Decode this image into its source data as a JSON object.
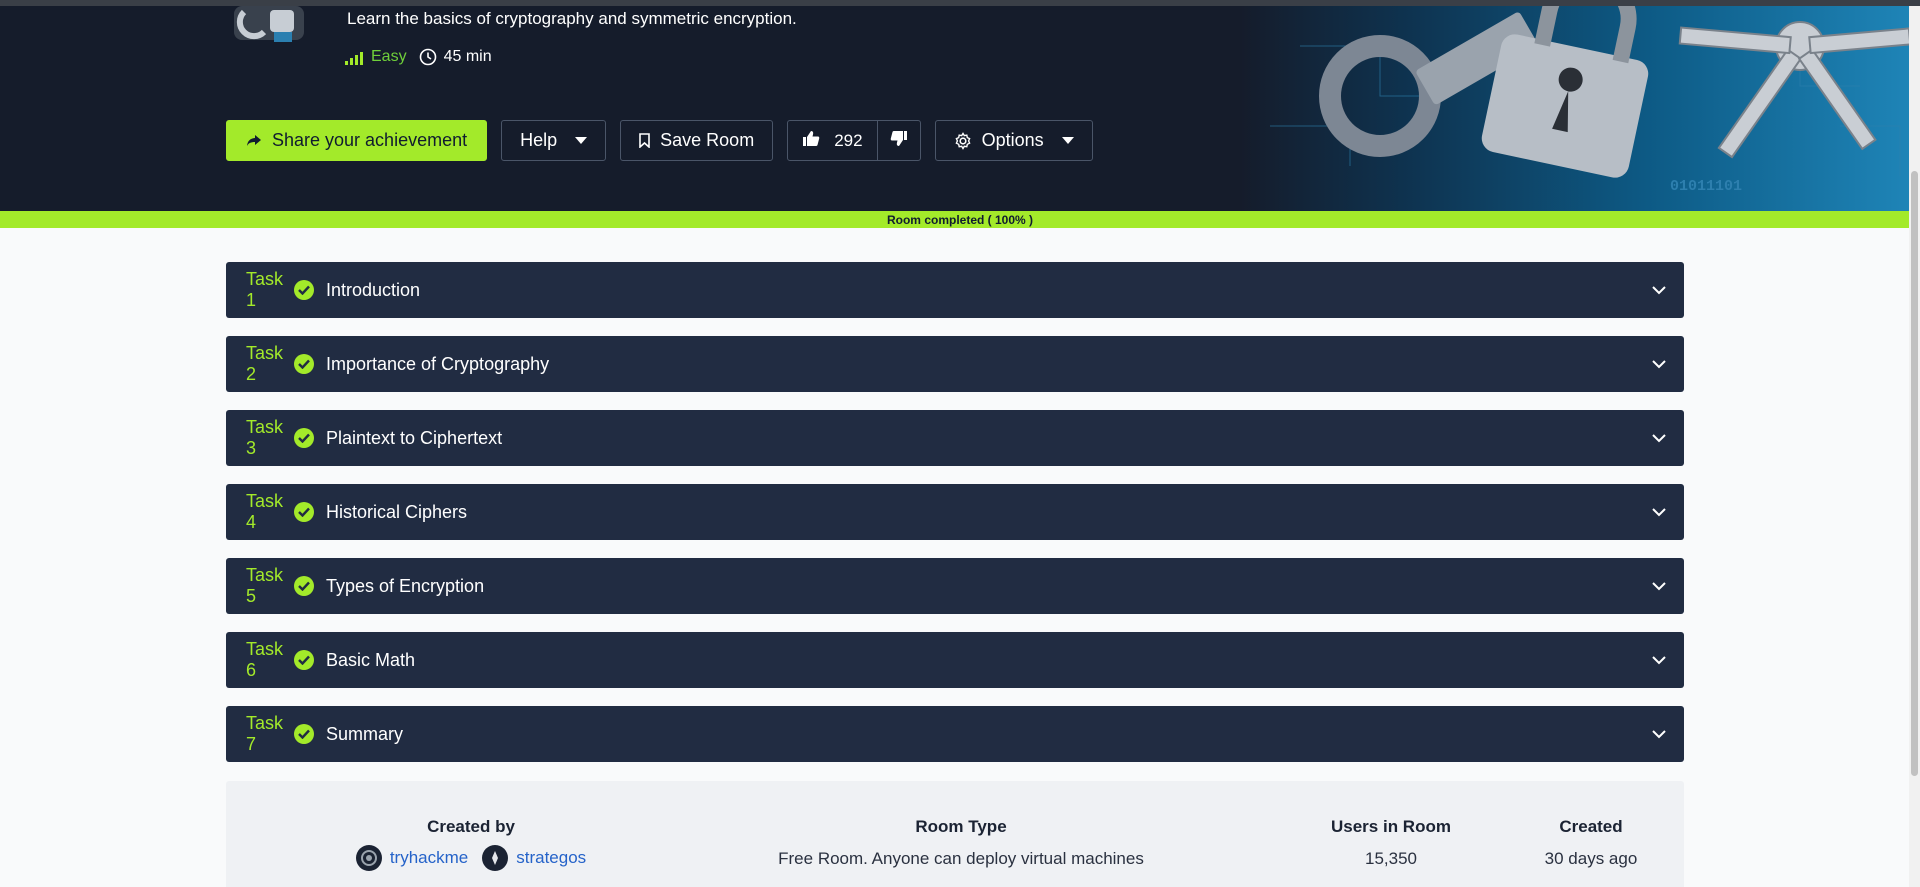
{
  "room": {
    "description": "Learn the basics of cryptography and symmetric encryption.",
    "difficulty": "Easy",
    "duration": "45 min"
  },
  "actions": {
    "share_label": "Share your achievement",
    "help_label": "Help",
    "save_label": "Save Room",
    "upvotes": "292",
    "options_label": "Options"
  },
  "progress": {
    "label": "Room completed ( 100% )",
    "percent": 100
  },
  "hero_art": {
    "binary_text": "01011101"
  },
  "tasks": [
    {
      "number": "Task 1",
      "title": "Introduction",
      "completed": true
    },
    {
      "number": "Task 2",
      "title": "Importance of Cryptography",
      "completed": true
    },
    {
      "number": "Task 3",
      "title": "Plaintext to Ciphertext",
      "completed": true
    },
    {
      "number": "Task 4",
      "title": "Historical Ciphers",
      "completed": true
    },
    {
      "number": "Task 5",
      "title": "Types of Encryption",
      "completed": true
    },
    {
      "number": "Task 6",
      "title": "Basic Math",
      "completed": true
    },
    {
      "number": "Task 7",
      "title": "Summary",
      "completed": true
    }
  ],
  "info": {
    "created_by_label": "Created by",
    "creators": [
      "tryhackme",
      "strategos"
    ],
    "room_type_label": "Room Type",
    "room_type_value": "Free Room. Anyone can deploy virtual machines",
    "users_label": "Users in Room",
    "users_value": "15,350",
    "created_label": "Created",
    "created_value": "30 days ago"
  },
  "colors": {
    "accent": "#a3ea2a",
    "hero_bg": "#151c2b",
    "task_bg": "#212c42",
    "link": "#2563c9"
  }
}
